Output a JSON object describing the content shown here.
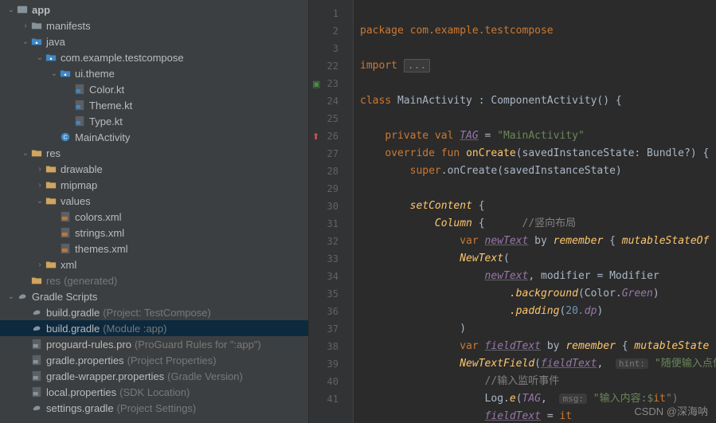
{
  "watermark": "CSDN @深海呐",
  "tree": [
    {
      "depth": 0,
      "exp": "down",
      "icon": "mod",
      "label": "app",
      "bold": true
    },
    {
      "depth": 1,
      "exp": "right",
      "icon": "folder",
      "label": "manifests"
    },
    {
      "depth": 1,
      "exp": "down",
      "icon": "pkg",
      "label": "java"
    },
    {
      "depth": 2,
      "exp": "down",
      "icon": "pkg",
      "label": "com.example.testcompose"
    },
    {
      "depth": 3,
      "exp": "down",
      "icon": "pkg",
      "label": "ui.theme"
    },
    {
      "depth": 4,
      "exp": "",
      "icon": "kt",
      "label": "Color.kt"
    },
    {
      "depth": 4,
      "exp": "",
      "icon": "kt",
      "label": "Theme.kt"
    },
    {
      "depth": 4,
      "exp": "",
      "icon": "kt",
      "label": "Type.kt"
    },
    {
      "depth": 3,
      "exp": "",
      "icon": "ktc",
      "label": "MainActivity"
    },
    {
      "depth": 1,
      "exp": "down",
      "icon": "res",
      "label": "res"
    },
    {
      "depth": 2,
      "exp": "right",
      "icon": "res",
      "label": "drawable"
    },
    {
      "depth": 2,
      "exp": "right",
      "icon": "res",
      "label": "mipmap"
    },
    {
      "depth": 2,
      "exp": "down",
      "icon": "res",
      "label": "values"
    },
    {
      "depth": 3,
      "exp": "",
      "icon": "xml",
      "label": "colors.xml"
    },
    {
      "depth": 3,
      "exp": "",
      "icon": "xml",
      "label": "strings.xml"
    },
    {
      "depth": 3,
      "exp": "",
      "icon": "xml",
      "label": "themes.xml"
    },
    {
      "depth": 2,
      "exp": "right",
      "icon": "res",
      "label": "xml"
    },
    {
      "depth": 1,
      "exp": "",
      "icon": "res",
      "label": "res",
      "paren": "(generated)",
      "dim": true
    },
    {
      "depth": 0,
      "exp": "down",
      "icon": "gradle",
      "label": "Gradle Scripts"
    },
    {
      "depth": 1,
      "exp": "",
      "icon": "gradle",
      "label": "build.gradle",
      "paren": "(Project: TestCompose)"
    },
    {
      "depth": 1,
      "exp": "",
      "icon": "gradle",
      "label": "build.gradle",
      "paren": "(Module :app)",
      "selected": true
    },
    {
      "depth": 1,
      "exp": "",
      "icon": "props",
      "label": "proguard-rules.pro",
      "paren": "(ProGuard Rules for \":app\")"
    },
    {
      "depth": 1,
      "exp": "",
      "icon": "props",
      "label": "gradle.properties",
      "paren": "(Project Properties)"
    },
    {
      "depth": 1,
      "exp": "",
      "icon": "props",
      "label": "gradle-wrapper.properties",
      "paren": "(Gradle Version)"
    },
    {
      "depth": 1,
      "exp": "",
      "icon": "props",
      "label": "local.properties",
      "paren": "(SDK Location)"
    },
    {
      "depth": 1,
      "exp": "",
      "icon": "gradle",
      "label": "settings.gradle",
      "paren": "(Project Settings)"
    }
  ],
  "lines": [
    1,
    2,
    3,
    22,
    23,
    24,
    25,
    26,
    27,
    28,
    29,
    30,
    31,
    32,
    33,
    34,
    35,
    36,
    37,
    38,
    39,
    40,
    41
  ],
  "gutterIcons": {
    "23": "compose",
    "26": "override"
  },
  "code": {
    "l1": "package com.example.testcompose",
    "l3_kw": "import",
    "l3_fold": "...",
    "l23": "class MainActivity : ComponentActivity() {",
    "l25_priv": "private val",
    "l25_tag": "TAG",
    "l25_eq": " = ",
    "l25_str": "\"MainActivity\"",
    "l26_ov": "override fun",
    "l26_fn": "onCreate",
    "l26_args": "(savedInstanceState: Bundle?) {",
    "l27_super": "super",
    "l27_call": ".onCreate(savedInstanceState)",
    "l29_fn": "setContent",
    "l29_b": " {",
    "l30_fn": "Column",
    "l30_b": " {",
    "l30_c": "      //竖向布局",
    "l31_var": "var",
    "l31_name": "newText",
    "l31_by": " by ",
    "l31_rem": "remember",
    "l31_b": " { ",
    "l31_mut": "mutableStateOf",
    "l32_fn": "NewText",
    "l32_p": "(",
    "l33_arg": "newText",
    "l33_mid": ", ",
    "l33_mod": "modifier",
    "l33_eq": " = Modifier",
    "l34_bg": ".background",
    "l34_col": "(Color.",
    "l34_green": "Green",
    "l34_close": ")",
    "l35_pad": ".padding",
    "l35_open": "(",
    "l35_num": "20",
    "l35_dp": ".dp",
    "l35_close": ")",
    "l36_close": ")",
    "l37_var": "var",
    "l37_name": "fieldText",
    "l37_by": " by ",
    "l37_rem": "remember",
    "l37_b": " { ",
    "l37_mut": "mutableState",
    "l38_fn": "NewTextField",
    "l38_p": "(",
    "l38_arg": "fieldText",
    "l38_c": ",  ",
    "l38_hint": "hint:",
    "l38_str": " \"随便输入点什么",
    "l39_c": "//输入监听事件",
    "l40_log": "Log.e(",
    "l40_tag": "TAG",
    "l40_c": ",  ",
    "l40_hint": "msg:",
    "l40_str": " \"输入内容:$",
    "l40_it": "it",
    "l40_end": "\")",
    "l41_f": "fieldText",
    "l41_eq": " = ",
    "l41_it": "it"
  }
}
